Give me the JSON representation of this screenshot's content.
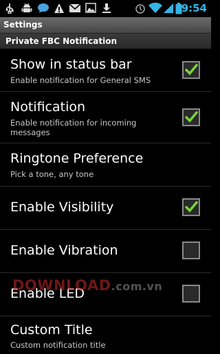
{
  "status_bar": {
    "time": "9:54",
    "icons": [
      "usb-icon",
      "android-debug-icon",
      "chat-icon",
      "warning-icon",
      "gmail-icon",
      "image-icon",
      "download-icon",
      "alarm-icon",
      "wifi-icon",
      "signal-icon",
      "battery-icon"
    ]
  },
  "title_bar": {
    "title": "Settings"
  },
  "category": {
    "title": "Private FBC Notification"
  },
  "preferences": [
    {
      "title": "Show in status bar",
      "summary": "Enable notification for General SMS",
      "checked": true
    },
    {
      "title": "Notification",
      "summary": "Enable notification for incoming messages",
      "checked": true
    },
    {
      "title": "Ringtone Preference",
      "summary": "Pick a tone, any tone"
    },
    {
      "title": "Enable Visibility",
      "summary": "",
      "checked": true
    },
    {
      "title": "Enable Vibration",
      "summary": "",
      "checked": false
    },
    {
      "title": "Enable LED",
      "summary": "",
      "checked": false
    },
    {
      "title": "Custom Title",
      "summary": "Custom notification title"
    }
  ],
  "watermark": {
    "brand": "DOWNLOAD",
    "suffix": ".com.vn"
  },
  "colors": {
    "accent": "#33b5e5",
    "check": "#7bd23c",
    "background": "#000000"
  }
}
